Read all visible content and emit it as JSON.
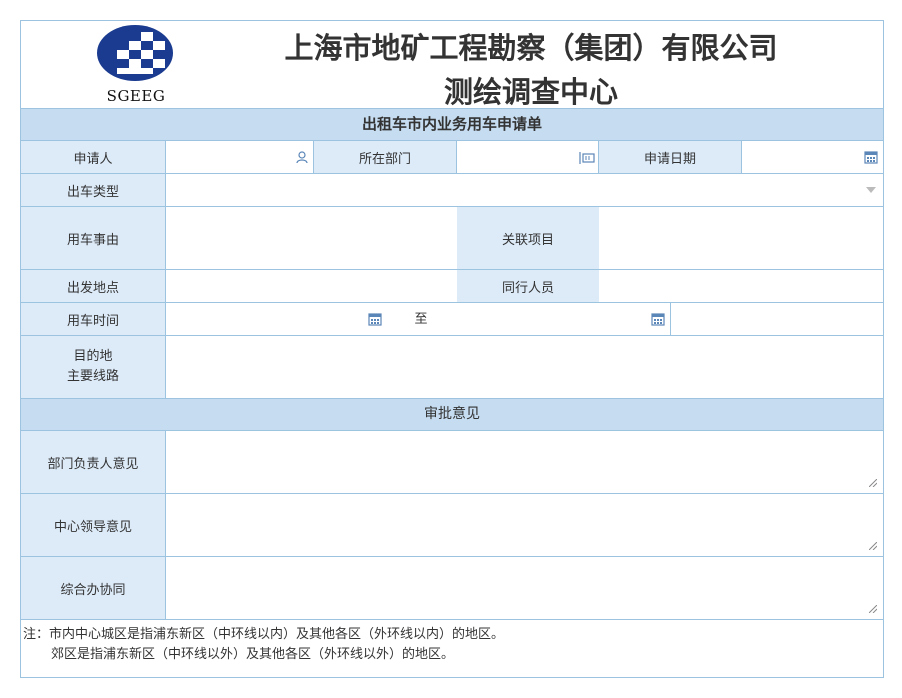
{
  "header": {
    "company": "上海市地矿工程勘察（集团）有限公司",
    "department": "测绘调查中心",
    "logo_text": "SGEEG"
  },
  "form": {
    "title": "出租车市内业务用车申请单",
    "labels": {
      "applicant": "申请人",
      "department": "所在部门",
      "apply_date": "申请日期",
      "car_type": "出车类型",
      "purpose": "用车事由",
      "related_project": "关联项目",
      "departure": "出发地点",
      "companions": "同行人员",
      "use_time": "用车时间",
      "to": "至",
      "destination_line1": "目的地",
      "destination_line2": "主要线路"
    },
    "values": {
      "applicant": "",
      "department": "",
      "apply_date": "",
      "car_type": "",
      "purpose": "",
      "related_project": "",
      "departure": "",
      "companions": "",
      "time_start": "",
      "time_end": "",
      "destination": ""
    }
  },
  "approval": {
    "title": "审批意见",
    "dept_head": "部门负责人意见",
    "center_leader": "中心领导意见",
    "general_office": "综合办协同"
  },
  "note": {
    "line1": "注：市内中心城区是指浦东新区（中环线以内）及其他各区（外环线以内）的地区。",
    "line2": "郊区是指浦东新区（中环线以外）及其他各区（外环线以外）的地区。"
  },
  "icons": {
    "applicant": "person-icon",
    "department": "org-picker-icon",
    "date": "calendar-icon",
    "car_type": "dropdown-arrow-icon"
  },
  "colors": {
    "border": "#9cc3e0",
    "label_bg": "#ddebf9",
    "band_bg": "#c6dcf0",
    "icon": "#5a86b8"
  }
}
